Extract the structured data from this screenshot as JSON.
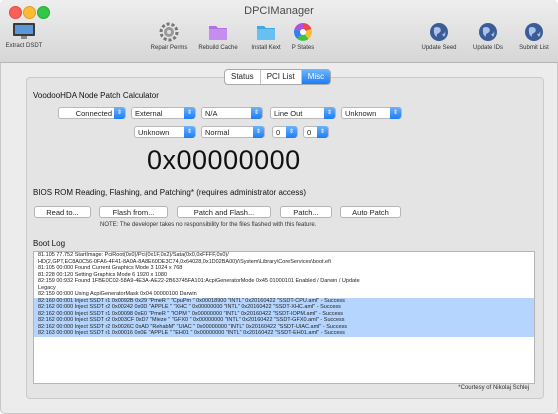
{
  "window": {
    "title": "DPCIManager"
  },
  "toolbar": {
    "extract": "Extract DSDT",
    "repair": "Repair Perms",
    "rebuild": "Rebuild Cache",
    "install": "Install Kext",
    "pstates": "P States",
    "update_seed": "Update Seed",
    "update_ids": "Update IDs",
    "submit_list": "Submit List"
  },
  "tabs": [
    {
      "label": "Status"
    },
    {
      "label": "PCI List"
    },
    {
      "label": "Misc"
    }
  ],
  "selected_tab": "Misc",
  "hda": {
    "title": "VoodooHDA Node Patch Calculator",
    "connection": "Connected",
    "location": "External",
    "na": "N/A",
    "device": "Line Out",
    "unknown1": "Unknown",
    "unknown2": "Unknown",
    "mode": "Normal",
    "num1": "0",
    "num2": "0",
    "result": "0x00000000"
  },
  "bios": {
    "title": "BIOS ROM Reading, Flashing, and Patching* (requires administrator access)",
    "read": "Read to...",
    "flash_from": "Flash from...",
    "patch_flash": "Patch and Flash...",
    "patch": "Patch...",
    "auto_patch": "Auto Patch",
    "note": "NOTE: The developer takes no responsibility for the files flashed with this feature."
  },
  "bootlog": {
    "title": "Boot Log",
    "lines": [
      "81.105 77.752 StartImage: PciRoot(0x0)/Pci(0x1F,0x2)/Sata(0x0,0xFFFF,0x0)/",
      "HD(2,GPT,EC8A0C56-0FA6-4F41-8A0A-8A8E60DE3C74,0x64028,0x1D02BA00)/\\System\\Library\\CoreServices\\boot.efi",
      "81:105 00:000 Found Current Graphics Mode 3 1024 x 768",
      "81:228 00:120 Setting Graphics Mode 6 1920 x 1080",
      "82:159 00:932 Found 1FBE0C02-58A9-4E3A-AE22-2B63745FA101:AcpiGeneratorMode 0x45 01000101 Enabled / Darwin / Update",
      "Legacy",
      "82:159 00:000 Using AcpiGeneratorMask 0x04 00000100 Darwin",
      "82:160 00:001 Inject SSDT r1  0x0092B 0x29 \"PmeR \" \"CpuPm \"  0x00018900 \"INTL\" 0x20160422 \"SSDT-CPU.aml\" - Success",
      "82:162 00:000 Inject SSDT r2  0x00242 0x0D \"APPLE \" \"XHC \"  0x00000000 \"INTL\" 0x20160422 \"SSDT-XHC.aml\" - Success",
      "82:162 00:000 Inject SSDT r1  0x00098 0xE0 \"PmeR \" \"IOPM \"  0x00000000 \"INTL\" 0x20160422 \"SSDT-IOPM.aml\" - Success",
      "82:162 00:000 Inject SSDT r2  0x003CF 0xD7 \"Mieze \" \"GFX0 \"  0x00000000 \"INTL\" 0x20160422 \"SSDT-GFX0.aml\" - Success",
      "82:162 00:000 Inject SSDT r2  0x0026C 0xAD \"RehabM\" \"UIAC \"  0x00000000 \"INTL\" 0x20160422 \"SSDT-UIAC.aml\" - Success",
      "82:163 00:000 Inject SSDT r1  0x00016 0x0E \"APPLE \" \"EH01 \"  0x00000000 \"INTL\" 0x20160422 \"SSDT-EH01.aml\" - Success"
    ],
    "highlight_from": 7
  },
  "courtesy": "*Courtesy of Nikolaj Schlej"
}
